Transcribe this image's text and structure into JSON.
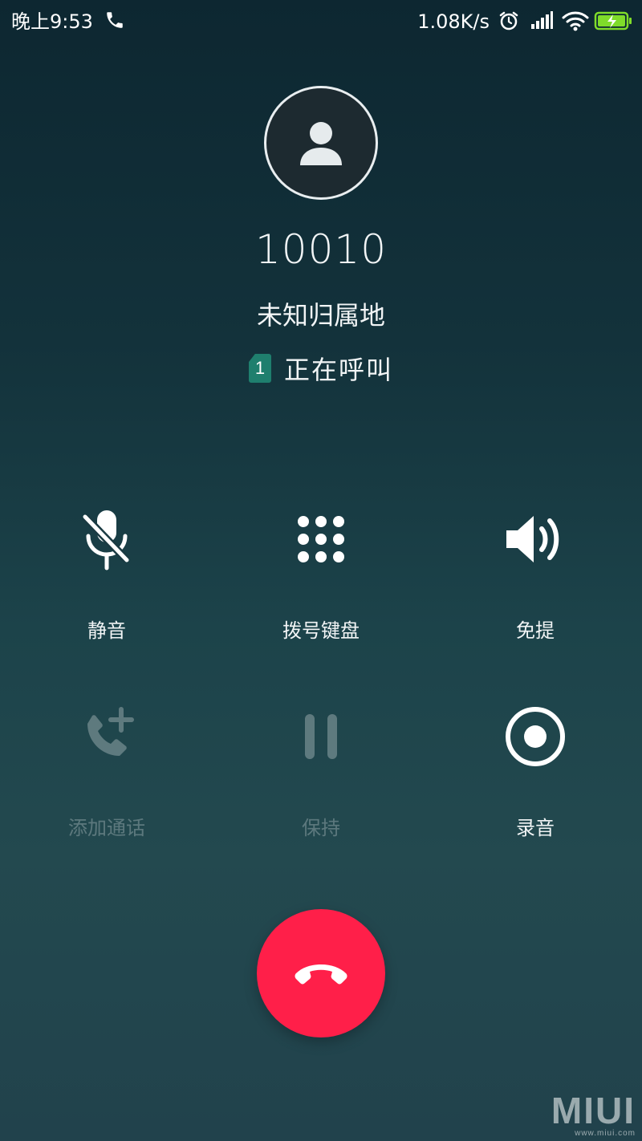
{
  "status_bar": {
    "time": "晚上9:53",
    "net_speed": "1.08K/s",
    "icons": [
      "phone-call-icon",
      "alarm-icon",
      "signal-icon",
      "wifi-icon",
      "battery-charging-icon"
    ]
  },
  "caller": {
    "number": "10010",
    "location": "未知归属地",
    "sim_slot": "1",
    "status": "正在呼叫"
  },
  "controls": {
    "mute": {
      "label": "静音",
      "icon": "mute-mic-icon"
    },
    "keypad": {
      "label": "拨号键盘",
      "icon": "dialpad-icon"
    },
    "speaker": {
      "label": "免提",
      "icon": "speaker-icon"
    },
    "add_call": {
      "label": "添加通话",
      "icon": "add-call-icon",
      "enabled": false
    },
    "hold": {
      "label": "保持",
      "icon": "pause-icon",
      "enabled": false
    },
    "record": {
      "label": "录音",
      "icon": "record-icon",
      "enabled": true
    }
  },
  "end_call": {
    "icon": "hang-up-icon",
    "color": "#ff1f49"
  },
  "watermark": {
    "brand": "MIUI",
    "site": "www.miui.com"
  }
}
